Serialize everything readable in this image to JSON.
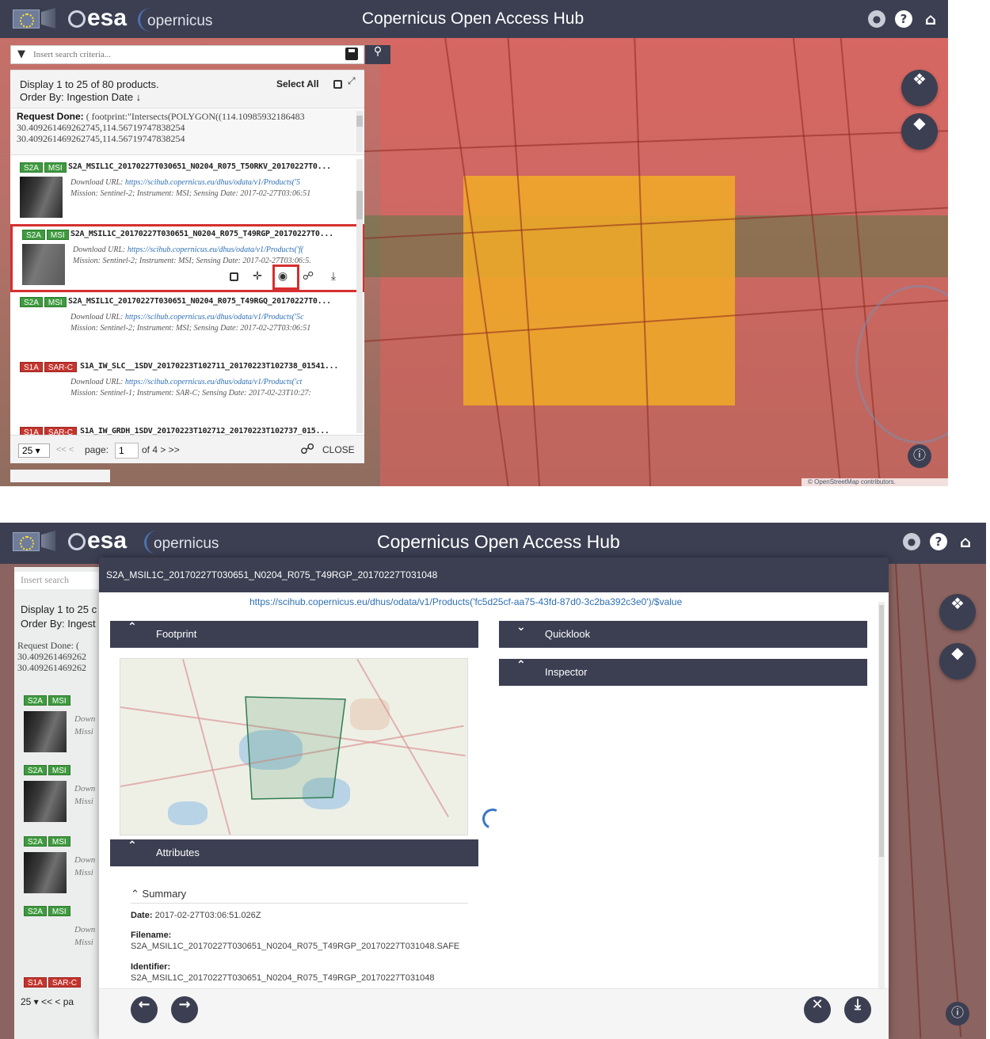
{
  "header": {
    "esa_logo": "esa",
    "copernicus_logo": "opernicus",
    "title": "Copernicus Open Access Hub",
    "icons": [
      "user-icon",
      "help-icon",
      "home-icon"
    ]
  },
  "search": {
    "placeholder": "Insert search criteria..."
  },
  "results": {
    "count_text": "Display 1 to 25 of 80 products.",
    "order_text": "Order By: Ingestion Date ↓",
    "select_all": "Select All",
    "request_label": "Request Done:",
    "request_text": "( footprint:\"Intersects(POLYGON((114.10985932186483",
    "request_line2": "30.409261469262745,114.56719747838254",
    "request_line3": "30.409261469262745,114.56719747838254",
    "products": [
      {
        "mission_tag": "S2A",
        "instrument_tag": "MSI",
        "name": "S2A_MSIL1C_20170227T030651_N0204_R075_T50RKV_20170227T0...",
        "download_label": "Download URL:",
        "download_url": "https://scihub.copernicus.eu/dhus/odata/v1/Products('5",
        "meta": "Mission: Sentinel-2; Instrument: MSI; Sensing Date: 2017-02-27T03:06:51"
      },
      {
        "mission_tag": "S2A",
        "instrument_tag": "MSI",
        "name": "S2A_MSIL1C_20170227T030651_N0204_R075_T49RGP_20170227T0...",
        "download_label": "Download URL:",
        "download_url": "https://scihub.copernicus.eu/dhus/odata/v1/Products('f(",
        "meta": "Mission: Sentinel-2; Instrument: MSI; Sensing Date: 2017-02-27T03:06:5."
      },
      {
        "mission_tag": "S2A",
        "instrument_tag": "MSI",
        "name": "S2A_MSIL1C_20170227T030651_N0204_R075_T49RGQ_20170227T0...",
        "download_label": "Download URL:",
        "download_url": "https://scihub.copernicus.eu/dhus/odata/v1/Products('5c",
        "meta": "Mission: Sentinel-2; Instrument: MSI; Sensing Date: 2017-02-27T03:06:51"
      },
      {
        "mission_tag": "S1A",
        "instrument_tag": "SAR-C",
        "name": "S1A_IW_SLC__1SDV_20170223T102711_20170223T102738_01541...",
        "download_label": "Download URL:",
        "download_url": "https://scihub.copernicus.eu/dhus/odata/v1/Products('ct",
        "meta": "Mission: Sentinel-1; Instrument: SAR-C; Sensing Date: 2017-02-23T10:27:"
      },
      {
        "mission_tag": "S1A",
        "instrument_tag": "SAR-C",
        "name": "S1A_IW_GRDH_1SDV_20170223T102712_20170223T102737_015..."
      }
    ],
    "pager": {
      "page_size": "25 ▾",
      "prev": "<< < ",
      "page_label": "page:",
      "page_value": "1",
      "of_text": "of 4 > >>",
      "close": "CLOSE"
    }
  },
  "map": {
    "attribution": "© OpenStreetMap contributors.",
    "fab_pan": "❖",
    "fab_layers": "◆",
    "info": "ⓘ"
  },
  "modal": {
    "title": "S2A_MSIL1C_20170227T030651_N0204_R075_T49RGP_20170227T031048",
    "url": "https://scihub.copernicus.eu/dhus/odata/v1/Products('fc5d25cf-aa75-43fd-87d0-3c2ba392c3e0')/$value",
    "sections": {
      "footprint": "Footprint",
      "quicklook": "Quicklook",
      "inspector": "Inspector",
      "attributes": "Attributes"
    },
    "summary_title": "Summary",
    "date_label": "Date:",
    "date_value": "2017-02-27T03:06:51.026Z",
    "filename_label": "Filename:",
    "filename_value": "S2A_MSIL1C_20170227T030651_N0204_R075_T49RGP_20170227T031048.SAFE",
    "identifier_label": "Identifier:",
    "identifier_value": "S2A_MSIL1C_20170227T030651_N0204_R075_T49RGP_20170227T031048"
  },
  "background_panel": {
    "search_placeholder": "Insert search",
    "count_text": "Display 1 to 25 c",
    "order_text": "Order By: Ingest",
    "request_label": "Request Done: (",
    "req_line2": "30.409261469262",
    "req_line3": "30.409261469262",
    "row_download": "Down",
    "row_mission": "Missi",
    "page_size": "25 ▾",
    "pager_rest": "<< < pa"
  },
  "colors": {
    "header_bg": "#3c3f52",
    "highlight": "#d62f2f",
    "tag_green": "#3f9a3f",
    "tag_red": "#c4352e",
    "footprint_yellow": "#f0aa28",
    "link": "#2e6fb4"
  }
}
